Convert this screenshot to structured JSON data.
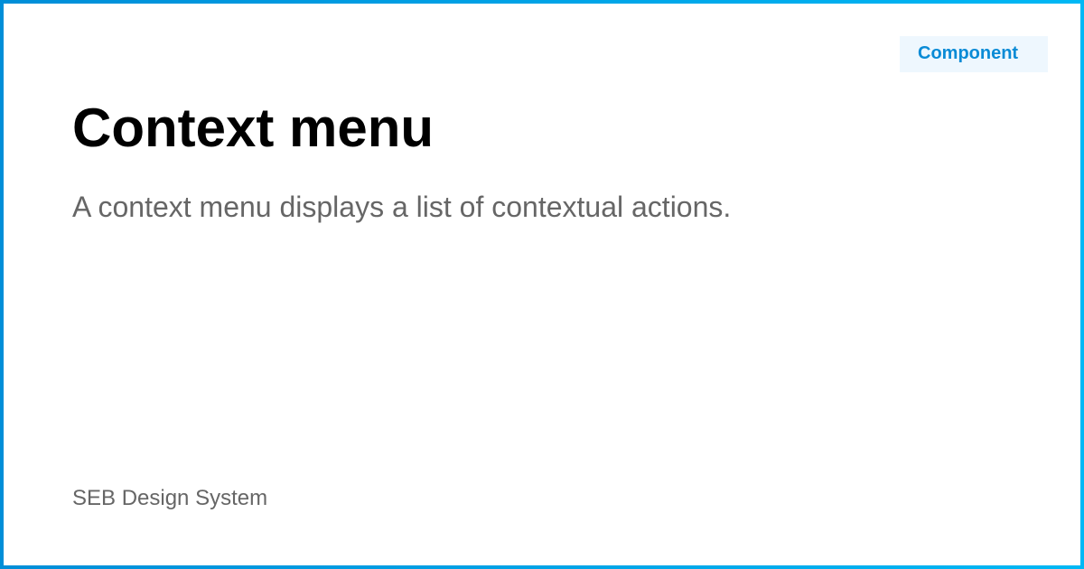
{
  "badge": {
    "label": "Component"
  },
  "page": {
    "title": "Context menu",
    "description": "A context menu displays a list of contextual actions.",
    "footer": "SEB Design System"
  },
  "colors": {
    "border_gradient_start": "#008ed8",
    "border_gradient_end": "#00b8f5",
    "badge_background": "#eef7fe",
    "badge_text": "#0a8bd6",
    "title_text": "#000000",
    "secondary_text": "#666666"
  }
}
